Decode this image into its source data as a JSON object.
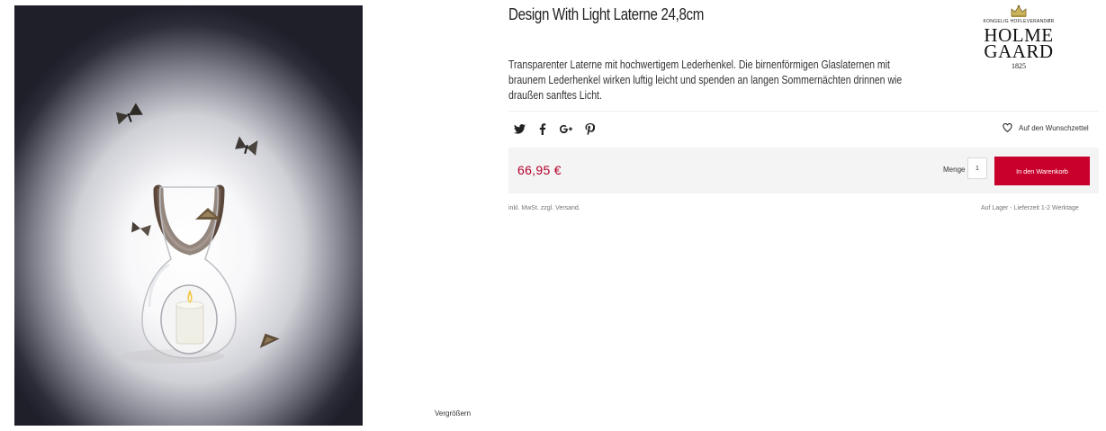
{
  "product": {
    "title": "Design With Light Laterne 24,8cm",
    "description": "Transparenter Laterne mit hochwertigem Lederhenkel. Die birnenförmigen Glaslaternen mit braunem Lederhenkel wirken luftig leicht und spenden an langen Sommernächten drinnen wie draußen sanftes Licht.",
    "image_action": "Vergrößern"
  },
  "brand": {
    "supplier_line": "KONGELIG HOFLEVERANDØR",
    "name_line1": "HOLME",
    "name_line2": "GAARD",
    "year": "1825"
  },
  "social": {
    "icons": [
      "twitter-icon",
      "facebook-icon",
      "google-plus-icon",
      "pinterest-icon"
    ]
  },
  "wishlist": {
    "label": "Auf den Wunschzettel",
    "icon": "heart-icon"
  },
  "purchase": {
    "price": "66,95 €",
    "quantity_label": "Menge",
    "quantity_value": "1",
    "cart_button": "In den Warenkorb",
    "tax_note": "inkl. MwSt. zzgl. Versand.",
    "stock_note": "Auf Lager - Lieferzeit 1-2 Werktage"
  },
  "colors": {
    "price": "#b5002a",
    "cart_button": "#c8002b",
    "buy_box_bg": "#f4f4f4"
  }
}
